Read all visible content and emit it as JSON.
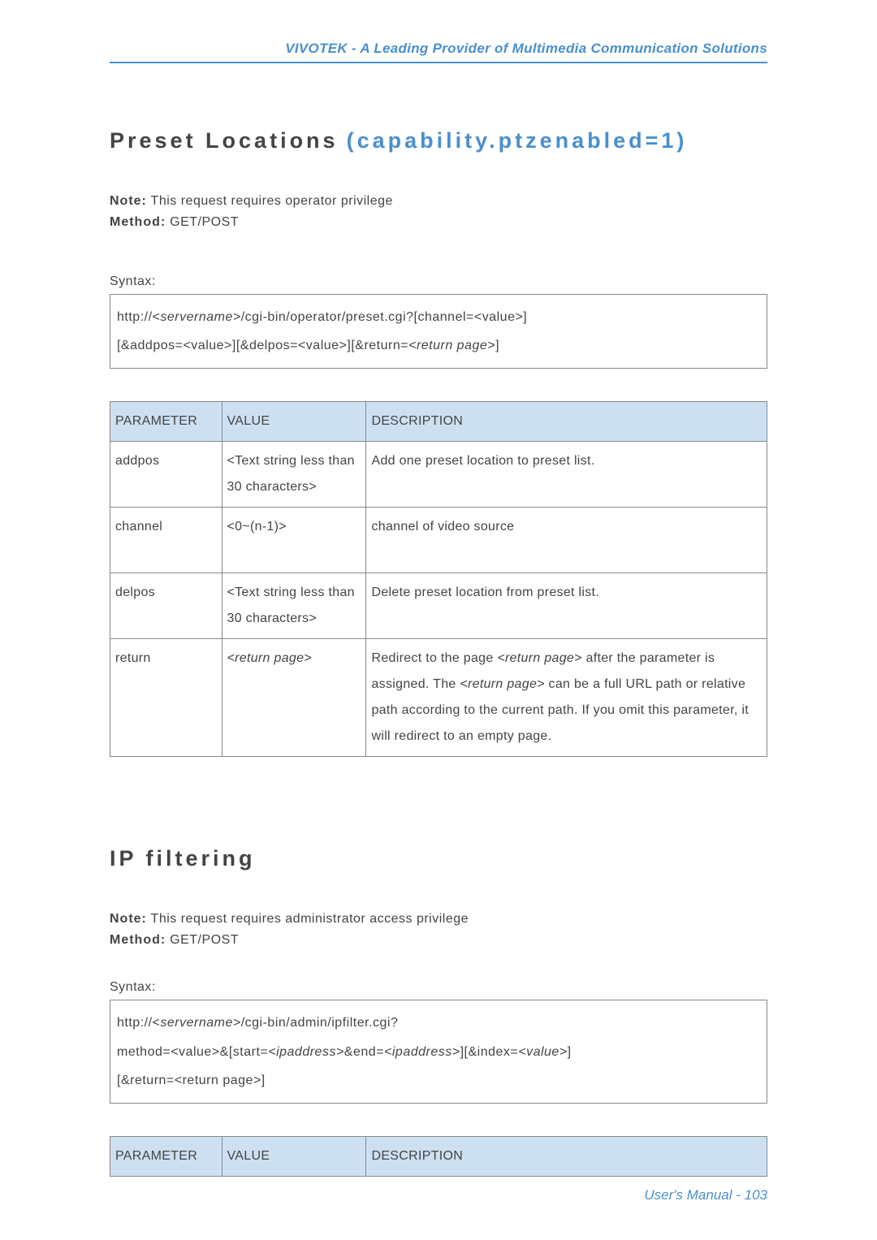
{
  "header": "VIVOTEK - A Leading Provider of Multimedia Communication Solutions",
  "section1": {
    "title_main": "Preset Locations",
    "title_suffix": "(capability.ptzenabled=1)",
    "note_label": "Note:",
    "note_text": " This request requires operator privilege",
    "method_label": "Method:",
    "method_text": " GET/POST",
    "syntax_label": "Syntax:",
    "syntax_line1_a": "http://<",
    "syntax_line1_b": "servername>",
    "syntax_line1_c": "/cgi-bin/operator/preset.cgi?[channel=<value>]",
    "syntax_line2_a": "[&addpos=<value>][&delpos=<value>][&return=",
    "syntax_line2_b": "<return page>",
    "syntax_line2_c": "]",
    "table": {
      "headers": {
        "p": "PARAMETER",
        "v": "VALUE",
        "d": "DESCRIPTION"
      },
      "rows": [
        {
          "p": "addpos",
          "v": "<Text string less than 30 characters>",
          "d": "Add one preset location to preset list."
        },
        {
          "p": "channel",
          "v": "<0~(n-1)>",
          "d": "channel of video source"
        },
        {
          "p": "delpos",
          "v": "<Text string less than 30 characters>",
          "d": "Delete preset location from preset list."
        },
        {
          "p": "return",
          "v_ital": "<return page>",
          "d_parts": {
            "a": "Redirect to the page ",
            "b": "<return page>",
            "c": " after the parameter is assigned. The ",
            "d": "<return page>",
            "e": " can be a full URL path or relative path according to the current path. If you omit this parameter, it will redirect to an empty page."
          }
        }
      ]
    }
  },
  "section2": {
    "title": "IP filtering",
    "note_label": "Note:",
    "note_text": " This request requires administrator access privilege",
    "method_label": "Method:",
    "method_text": " GET/POST",
    "syntax_label": "Syntax:",
    "syntax_line1_a": "http://<",
    "syntax_line1_b": "servername>",
    "syntax_line1_c": "/cgi-bin/admin/ipfilter.cgi?",
    "syntax_line2_a": "method=<value>&[start=",
    "syntax_line2_b": "<ipaddress>",
    "syntax_line2_c": "&end=",
    "syntax_line2_d": "<ipaddress>",
    "syntax_line2_e": "][&index=",
    "syntax_line2_f": "<value>",
    "syntax_line2_g": "]",
    "syntax_line3": "[&return=<return page>]",
    "table": {
      "headers": {
        "p": "PARAMETER",
        "v": "VALUE",
        "d": "DESCRIPTION"
      }
    }
  },
  "footer": "User's Manual - 103"
}
